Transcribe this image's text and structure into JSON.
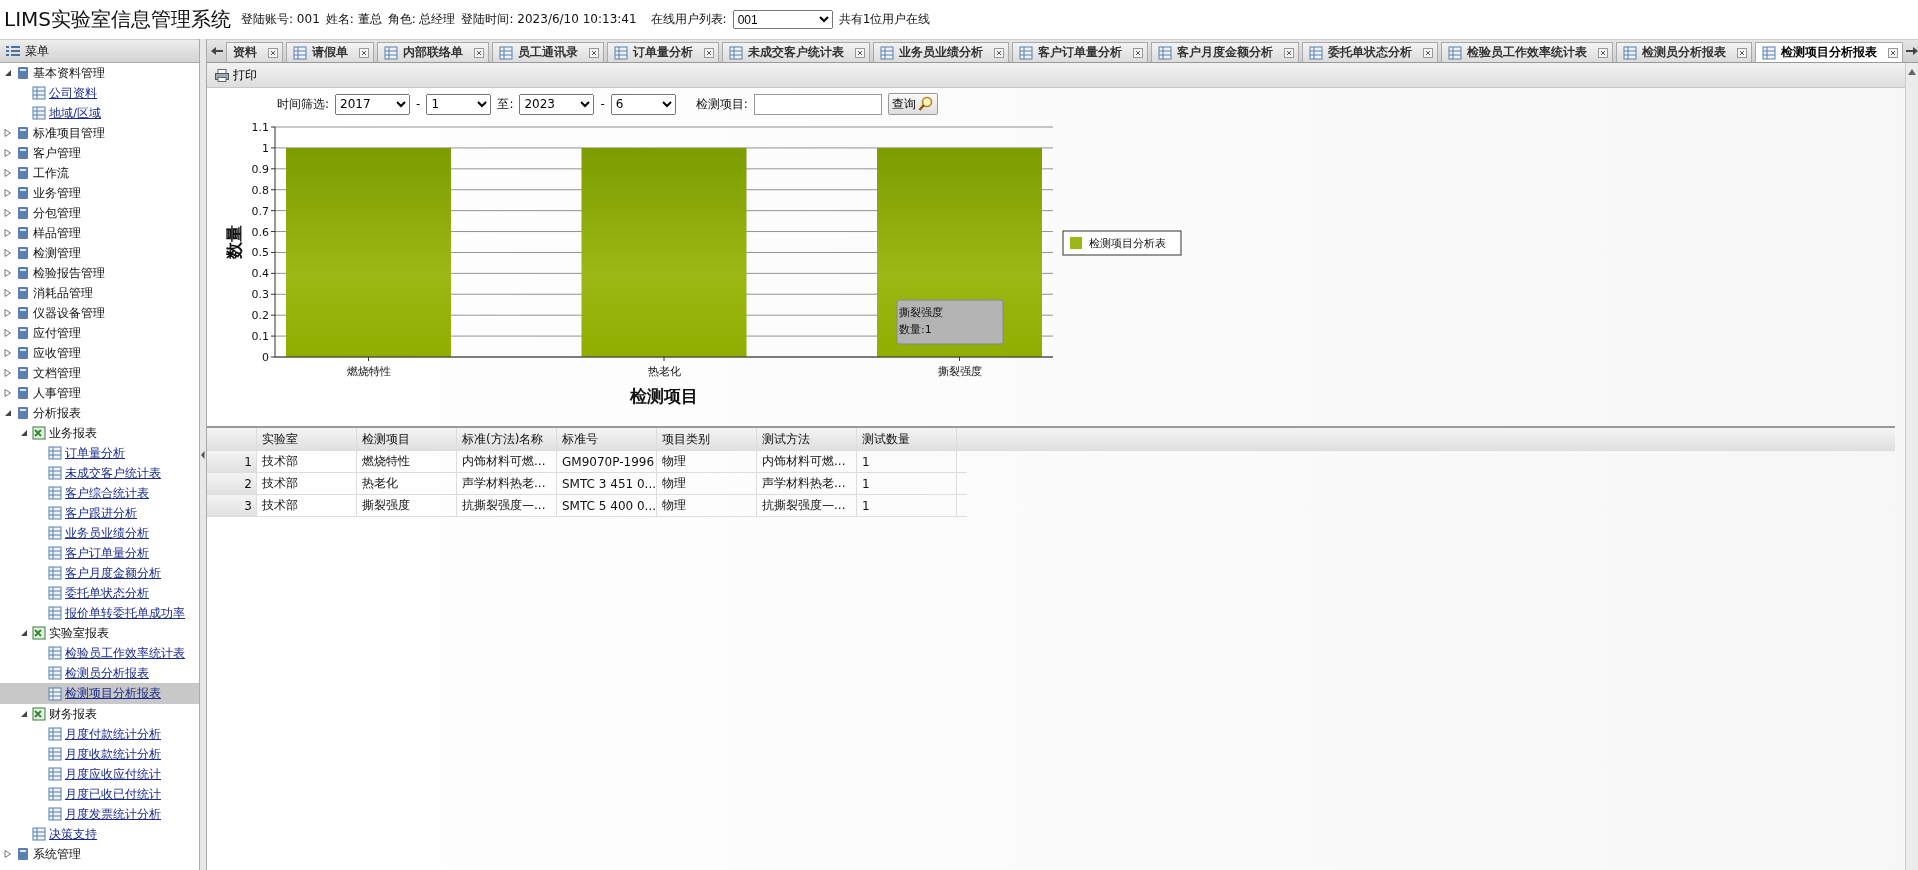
{
  "header": {
    "title": "LIMS实验室信息管理系统",
    "account_label": "登陆账号: 001",
    "name_label": "姓名: 董总",
    "role_label": "角色: 总经理",
    "login_time": "登陆时间: 2023/6/10 10:13:41",
    "online_label": "在线用户列表:",
    "online_user": "001",
    "online_count": "共有1位用户在线"
  },
  "sidebar": {
    "title": "菜单",
    "items": [
      {
        "label": "基本资料管理",
        "expanded": true,
        "selected": false,
        "children": [
          {
            "label": "公司资料",
            "selected": false
          },
          {
            "label": "地域/区域",
            "selected": false
          }
        ]
      },
      {
        "label": "标准项目管理",
        "expanded": false,
        "selected": false
      },
      {
        "label": "客户管理",
        "expanded": false,
        "selected": false
      },
      {
        "label": "工作流",
        "expanded": false,
        "selected": false
      },
      {
        "label": "业务管理",
        "expanded": false,
        "selected": false
      },
      {
        "label": "分包管理",
        "expanded": false,
        "selected": false
      },
      {
        "label": "样品管理",
        "expanded": false,
        "selected": false
      },
      {
        "label": "检测管理",
        "expanded": false,
        "selected": false
      },
      {
        "label": "检验报告管理",
        "expanded": false,
        "selected": false
      },
      {
        "label": "消耗品管理",
        "expanded": false,
        "selected": false
      },
      {
        "label": "仪器设备管理",
        "expanded": false,
        "selected": false
      },
      {
        "label": "应付管理",
        "expanded": false,
        "selected": false
      },
      {
        "label": "应收管理",
        "expanded": false,
        "selected": false
      },
      {
        "label": "文档管理",
        "expanded": false,
        "selected": false
      },
      {
        "label": "人事管理",
        "expanded": false,
        "selected": false
      },
      {
        "label": "分析报表",
        "expanded": true,
        "selected": false,
        "children": [
          {
            "label": "业务报表",
            "expanded": true,
            "selected": false,
            "children": [
              {
                "label": "订单量分析",
                "selected": false
              },
              {
                "label": "未成交客户统计表",
                "selected": false
              },
              {
                "label": "客户综合统计表",
                "selected": false
              },
              {
                "label": "客户跟进分析",
                "selected": false
              },
              {
                "label": "业务员业绩分析",
                "selected": false
              },
              {
                "label": "客户订单量分析",
                "selected": false
              },
              {
                "label": "客户月度金额分析",
                "selected": false
              },
              {
                "label": "委托单状态分析",
                "selected": false
              },
              {
                "label": "报价单转委托单成功率",
                "selected": false
              }
            ]
          },
          {
            "label": "实验室报表",
            "expanded": true,
            "selected": false,
            "children": [
              {
                "label": "检验员工作效率统计表",
                "selected": false
              },
              {
                "label": "检测员分析报表",
                "selected": false
              },
              {
                "label": "检测项目分析报表",
                "selected": true
              }
            ]
          },
          {
            "label": "财务报表",
            "expanded": true,
            "selected": false,
            "children": [
              {
                "label": "月度付款统计分析",
                "selected": false
              },
              {
                "label": "月度收款统计分析",
                "selected": false
              },
              {
                "label": "月度应收应付统计",
                "selected": false
              },
              {
                "label": "月度已收已付统计",
                "selected": false
              },
              {
                "label": "月度发票统计分析",
                "selected": false
              }
            ]
          },
          {
            "label": "决策支持",
            "selected": false
          }
        ]
      },
      {
        "label": "系统管理",
        "expanded": false,
        "selected": false
      }
    ]
  },
  "tabs": [
    {
      "label": "资料",
      "selected": false
    },
    {
      "label": "请假单",
      "selected": false
    },
    {
      "label": "内部联络单",
      "selected": false
    },
    {
      "label": "员工通讯录",
      "selected": false
    },
    {
      "label": "订单量分析",
      "selected": false
    },
    {
      "label": "未成交客户统计表",
      "selected": false
    },
    {
      "label": "业务员业绩分析",
      "selected": false
    },
    {
      "label": "客户订单量分析",
      "selected": false
    },
    {
      "label": "客户月度金额分析",
      "selected": false
    },
    {
      "label": "委托单状态分析",
      "selected": false
    },
    {
      "label": "检验员工作效率统计表",
      "selected": false
    },
    {
      "label": "检测员分析报表",
      "selected": false
    },
    {
      "label": "检测项目分析报表",
      "selected": true
    }
  ],
  "toolbar": {
    "print": "打印"
  },
  "filters": {
    "time_label": "时间筛选:",
    "from_year": "2017",
    "dash1": "-",
    "from_month": "1",
    "to_label": "至:",
    "to_year": "2023",
    "dash2": "-",
    "to_month": "6",
    "item_label": "检测项目:",
    "query": "查询"
  },
  "chart": {
    "chart_data": {
      "type": "bar",
      "xlabel": "检测项目",
      "ylabel": "数量",
      "categories": [
        "燃烧特性",
        "热老化",
        "撕裂强度"
      ],
      "series": [
        {
          "name": "检测项目分析表",
          "color": "#9bb814",
          "values": [
            1,
            1,
            1
          ]
        }
      ],
      "ylim": [
        0,
        1.1
      ],
      "grid": true,
      "yticks": [
        0,
        0.1,
        0.2,
        0.3,
        0.4,
        0.5,
        0.6,
        0.7,
        0.8,
        0.9,
        1,
        1.1
      ]
    },
    "tooltip": [
      "撕裂强度",
      "数量:1"
    ]
  },
  "table": {
    "columns": [
      "实验室",
      "检测项目",
      "标准(方法)名称",
      "标准号",
      "项目类别",
      "测试方法",
      "测试数量"
    ],
    "rows": [
      {
        "num": "1",
        "cells": [
          "技术部",
          "燃烧特性",
          "内饰材料可燃...",
          "GM9070P-1996",
          "物理",
          "内饰材料可燃...",
          "1"
        ]
      },
      {
        "num": "2",
        "cells": [
          "技术部",
          "热老化",
          "声学材料热老...",
          "SMTC 3 451 0...",
          "物理",
          "声学材料热老...",
          "1"
        ]
      },
      {
        "num": "3",
        "cells": [
          "技术部",
          "撕裂强度",
          "抗撕裂强度—...",
          "SMTC 5 400 0...",
          "物理",
          "抗撕裂强度—...",
          "1"
        ]
      }
    ]
  }
}
